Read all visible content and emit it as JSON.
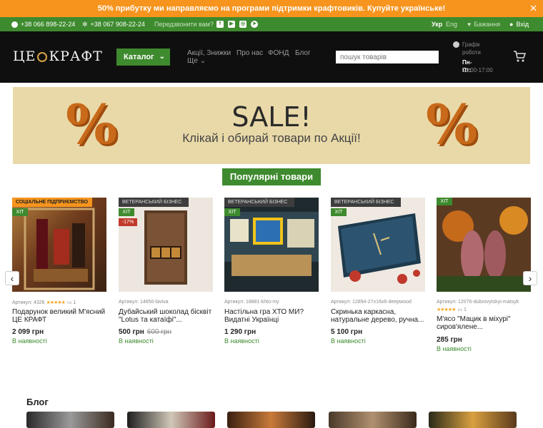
{
  "promo": {
    "text": "50% прибутку ми направляємо на програми підтримки крафтовиків. Купуйте українське!",
    "close": "✕"
  },
  "topbar": {
    "phone1": "+38 066 898-22-24",
    "phone2": "+38 067 908-22-24",
    "callback": "Передзвонити вам?",
    "lang_active": "Укр",
    "lang_other": "Eng",
    "wishlist": "Бажання",
    "login": "Вхід"
  },
  "header": {
    "logo_left": "ЦЕ",
    "logo_right": "КРАФТ",
    "catalog": "Каталог",
    "nav": [
      "Акції, Знижки",
      "Про нас",
      "ФОНД",
      "Блог",
      "Ще"
    ],
    "search_placeholder": "пошук товарів",
    "schedule_label": "Графік роботи",
    "schedule_days": "Пн-Пт:",
    "schedule_hours": "10:00-17:00"
  },
  "banner": {
    "title": "SALE!",
    "subtitle": "Клікай і обирай товари по Акції!"
  },
  "popular": {
    "title": "Популярні товари"
  },
  "products": [
    {
      "badge": "СОЦІАЛЬНЕ ПІДПРИЄМСТВО",
      "hit": "ХІТ",
      "sku": "Артикул: 4326",
      "stars": "★★★★★",
      "comments": "1",
      "name": "Подарунок великий М'ясний ЦЕ КРАФТ",
      "price": "2 099 грн",
      "availability": "В наявності"
    },
    {
      "badge": "ВЕТЕРАНСЬКИЙ БІЗНЕС",
      "hit": "ХІТ",
      "discount": "-17%",
      "sku": "Артикул: 14850-laviva",
      "name": "Дубайський шоколад бісквіт \"Lotus та катаїфі\"...",
      "price": "500 грн",
      "old_price": "600 грн",
      "availability": "В наявності"
    },
    {
      "badge": "ВЕТЕРАНСЬКИЙ БІЗНЕС",
      "hit": "ХІТ",
      "sku": "Артикул: 18881-khto-my",
      "name": "Настільна гра ХТО МИ? Видатні Українці",
      "price": "1 290 грн",
      "availability": "В наявності"
    },
    {
      "badge": "ВЕТЕРАНСЬКИЙ БІЗНЕС",
      "hit": "ХІТ",
      "sku": "Артикул: 12894-27x16x6-deepwood",
      "name": "Скринька каркасна, натуральне дерево, ручна...",
      "price": "5 100 грн",
      "availability": "В наявності"
    },
    {
      "hit": "ХІТ",
      "sku": "Артикул: 12076-dubrovytskyi-matsyk",
      "stars": "★★★★★",
      "comments": "1",
      "name": "М'ясо \"Мацик в міхурі\" сиров'ялене...",
      "price": "285 грн",
      "availability": "В наявності"
    }
  ],
  "blog": {
    "title": "Блог"
  },
  "icons": {
    "prev": "‹",
    "next": "›",
    "cart": "🛒"
  },
  "colors": {
    "accent_green": "#3e8a2e",
    "promo_orange": "#f7941d",
    "header_black": "#0f0f0f",
    "banner_sand": "#e9d9a8"
  }
}
